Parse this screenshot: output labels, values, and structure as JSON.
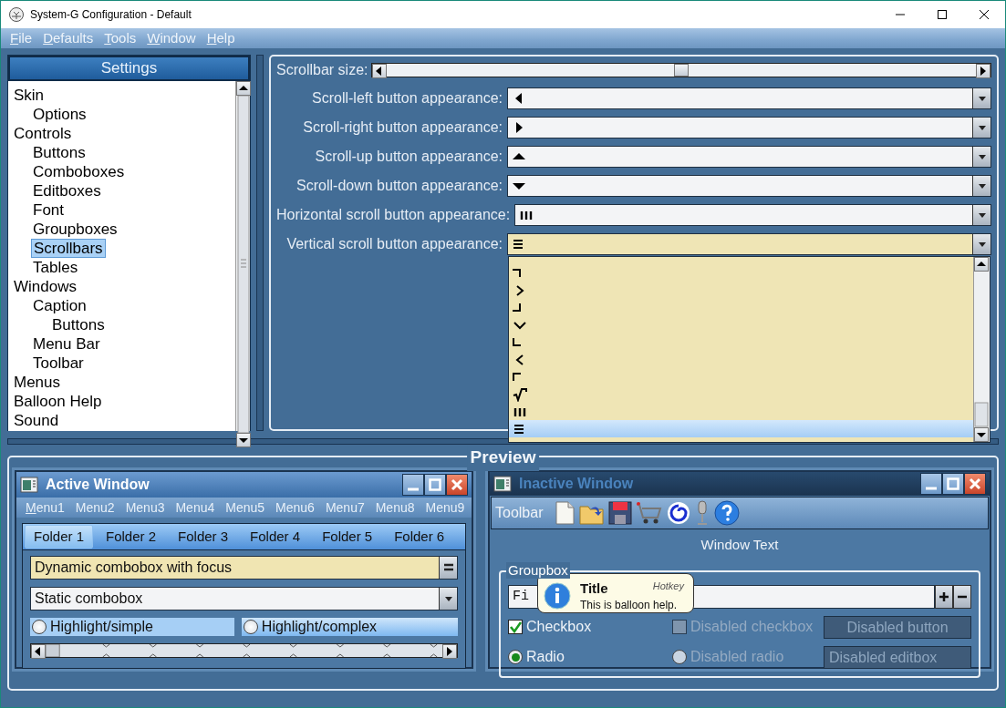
{
  "window": {
    "title": "System-G Configuration - Default"
  },
  "menu": [
    {
      "label": "File",
      "hotkey_underlined": true
    },
    {
      "label": "Defaults",
      "hotkey_underlined": true
    },
    {
      "label": "Tools",
      "hotkey_underlined": true
    },
    {
      "label": "Window",
      "hotkey_underlined": true
    },
    {
      "label": "Help",
      "hotkey_underlined": true
    }
  ],
  "sidebar": {
    "title": "Settings",
    "items": [
      {
        "label": "Skin",
        "selected": false,
        "children": [
          {
            "label": "Options",
            "selected": false
          }
        ]
      },
      {
        "label": "Controls",
        "selected": false,
        "children": [
          {
            "label": "Buttons",
            "selected": false
          },
          {
            "label": "Comboboxes",
            "selected": false
          },
          {
            "label": "Editboxes",
            "selected": false
          },
          {
            "label": "Font",
            "selected": false
          },
          {
            "label": "Groupboxes",
            "selected": false
          },
          {
            "label": "Scrollbars",
            "selected": true
          },
          {
            "label": "Tables",
            "selected": false
          }
        ]
      },
      {
        "label": "Windows",
        "selected": false,
        "children": [
          {
            "label": "Caption",
            "selected": false,
            "children": [
              {
                "label": "Buttons",
                "selected": false
              }
            ]
          },
          {
            "label": "Menu Bar",
            "selected": false
          },
          {
            "label": "Toolbar",
            "selected": false
          }
        ]
      },
      {
        "label": "Menus",
        "selected": false
      },
      {
        "label": "Balloon Help",
        "selected": false
      },
      {
        "label": "Sound",
        "selected": false
      }
    ]
  },
  "scrollbar_size": {
    "label": "Scrollbar size:",
    "level": 0.5
  },
  "appearance_settings": [
    {
      "label": "Scroll-left button appearance:",
      "kind": "triangle-left",
      "focused": false
    },
    {
      "label": "Scroll-right button appearance:",
      "kind": "triangle-right",
      "focused": false
    },
    {
      "label": "Scroll-up button appearance:",
      "kind": "triangle-up",
      "focused": false
    },
    {
      "label": "Scroll-down button appearance:",
      "kind": "triangle-down",
      "focused": false
    },
    {
      "label": "Horizontal scroll button appearance:",
      "kind": "bars-vertical",
      "focused": false
    },
    {
      "label": "Vertical scroll button appearance:",
      "kind": "bars-horizontal",
      "focused": true
    }
  ],
  "dropdown": {
    "options": [
      {
        "kind": "corner-top-right",
        "selected": false
      },
      {
        "kind": "chevron-right",
        "selected": false
      },
      {
        "kind": "corner-bottom-right",
        "selected": false
      },
      {
        "kind": "chevron-down",
        "selected": false
      },
      {
        "kind": "corner-bottom-left",
        "selected": false
      },
      {
        "kind": "chevron-left",
        "selected": false
      },
      {
        "kind": "corner-top-left",
        "selected": false
      },
      {
        "kind": "root-sign",
        "selected": false
      },
      {
        "kind": "bars-vertical",
        "selected": false
      },
      {
        "kind": "bars-horizontal",
        "selected": true
      }
    ]
  },
  "preview": {
    "title": "Preview",
    "active_window": {
      "title": "Active Window",
      "menus": [
        {
          "label": "Menu1",
          "hotkey_underlined": true
        },
        {
          "label": "Menu2",
          "hotkey_underlined": false
        },
        {
          "label": "Menu3",
          "hotkey_underlined": false
        },
        {
          "label": "Menu4",
          "hotkey_underlined": false
        },
        {
          "label": "Menu5",
          "hotkey_underlined": false
        },
        {
          "label": "Menu6",
          "hotkey_underlined": false
        },
        {
          "label": "Menu7",
          "hotkey_underlined": false
        },
        {
          "label": "Menu8",
          "hotkey_underlined": false
        },
        {
          "label": "Menu9",
          "hotkey_underlined": false
        }
      ],
      "tabs": [
        {
          "label": "Folder 1",
          "selected": true
        },
        {
          "label": "Folder 2",
          "selected": false
        },
        {
          "label": "Folder 3",
          "selected": false
        },
        {
          "label": "Folder 4",
          "selected": false
        },
        {
          "label": "Folder 5",
          "selected": false
        },
        {
          "label": "Folder 6",
          "selected": false
        }
      ],
      "dynamic_combobox": {
        "value": "Dynamic combobox with focus",
        "focused": true
      },
      "static_combobox": {
        "value": "Static combobox",
        "focused": false
      },
      "radios": [
        {
          "label": "Highlight/simple",
          "kind": "simple",
          "checked": false
        },
        {
          "label": "Highlight/complex",
          "kind": "complex",
          "checked": false
        }
      ]
    },
    "inactive_window": {
      "title": "Inactive Window",
      "toolbar_label": "Toolbar",
      "window_text": "Window Text",
      "groupbox": {
        "title": "Groupbox",
        "editbox": {
          "value": "Fi"
        },
        "checkbox": {
          "label": "Checkbox",
          "checked": true,
          "disabled": false
        },
        "disabled_checkbox": {
          "label": "Disabled checkbox",
          "checked": false,
          "disabled": true
        },
        "disabled_button": {
          "label": "Disabled button",
          "disabled": true
        },
        "radio": {
          "label": "Radio",
          "checked": true,
          "disabled": false
        },
        "disabled_radio": {
          "label": "Disabled radio",
          "checked": false,
          "disabled": true
        },
        "disabled_editbox": {
          "value": "Disabled editbox",
          "disabled": true
        }
      },
      "balloon": {
        "title": "Title",
        "hotkey": "Hotkey",
        "text": "This is balloon help."
      }
    }
  }
}
